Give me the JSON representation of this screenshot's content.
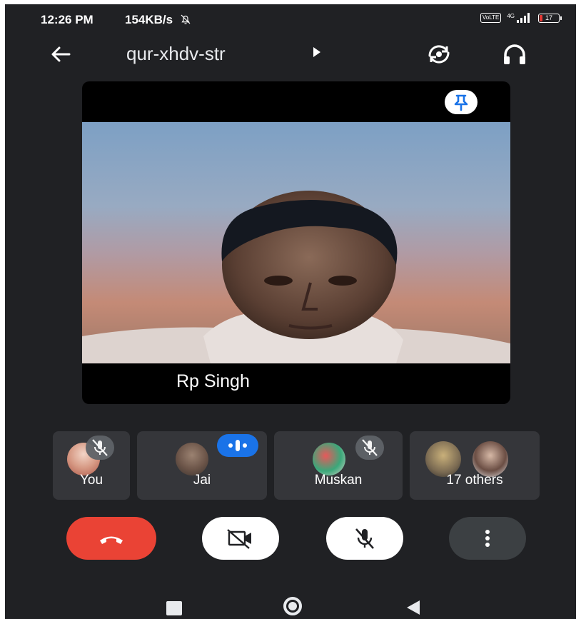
{
  "status_bar": {
    "time": "12:26 PM",
    "network_speed": "154KB/s",
    "silent_icon": "bell-off-icon",
    "volte_label": "VoLTE",
    "signal_label": "4G",
    "battery_level": "17",
    "battery_color": "#e53935"
  },
  "app_bar": {
    "meeting_code": "qur-xhdv-str",
    "back_icon": "arrow-left-icon",
    "switch_camera_icon": "switch-camera-icon",
    "audio_icon": "headphones-icon"
  },
  "main_tile": {
    "speaker_name": "Rp Singh",
    "pin_icon": "pin-icon",
    "pin_color": "#1a73e8"
  },
  "participants": [
    {
      "name": "You",
      "muted": true
    },
    {
      "name": "Jai",
      "muted": false,
      "speaking": true
    },
    {
      "name": "Muskan",
      "muted": true
    },
    {
      "name": "17 others",
      "muted": false
    }
  ],
  "controls": {
    "end_call_icon": "phone-hangup-icon",
    "camera_icon": "camera-off-icon",
    "mic_icon": "mic-off-icon",
    "more_icon": "more-vertical-icon",
    "end_call_color": "#ea4335",
    "accent_blue": "#1a73e8"
  },
  "nav_bar": {
    "recent_icon": "square-recent-icon",
    "home_icon": "circle-home-icon",
    "back_icon": "triangle-back-icon"
  }
}
